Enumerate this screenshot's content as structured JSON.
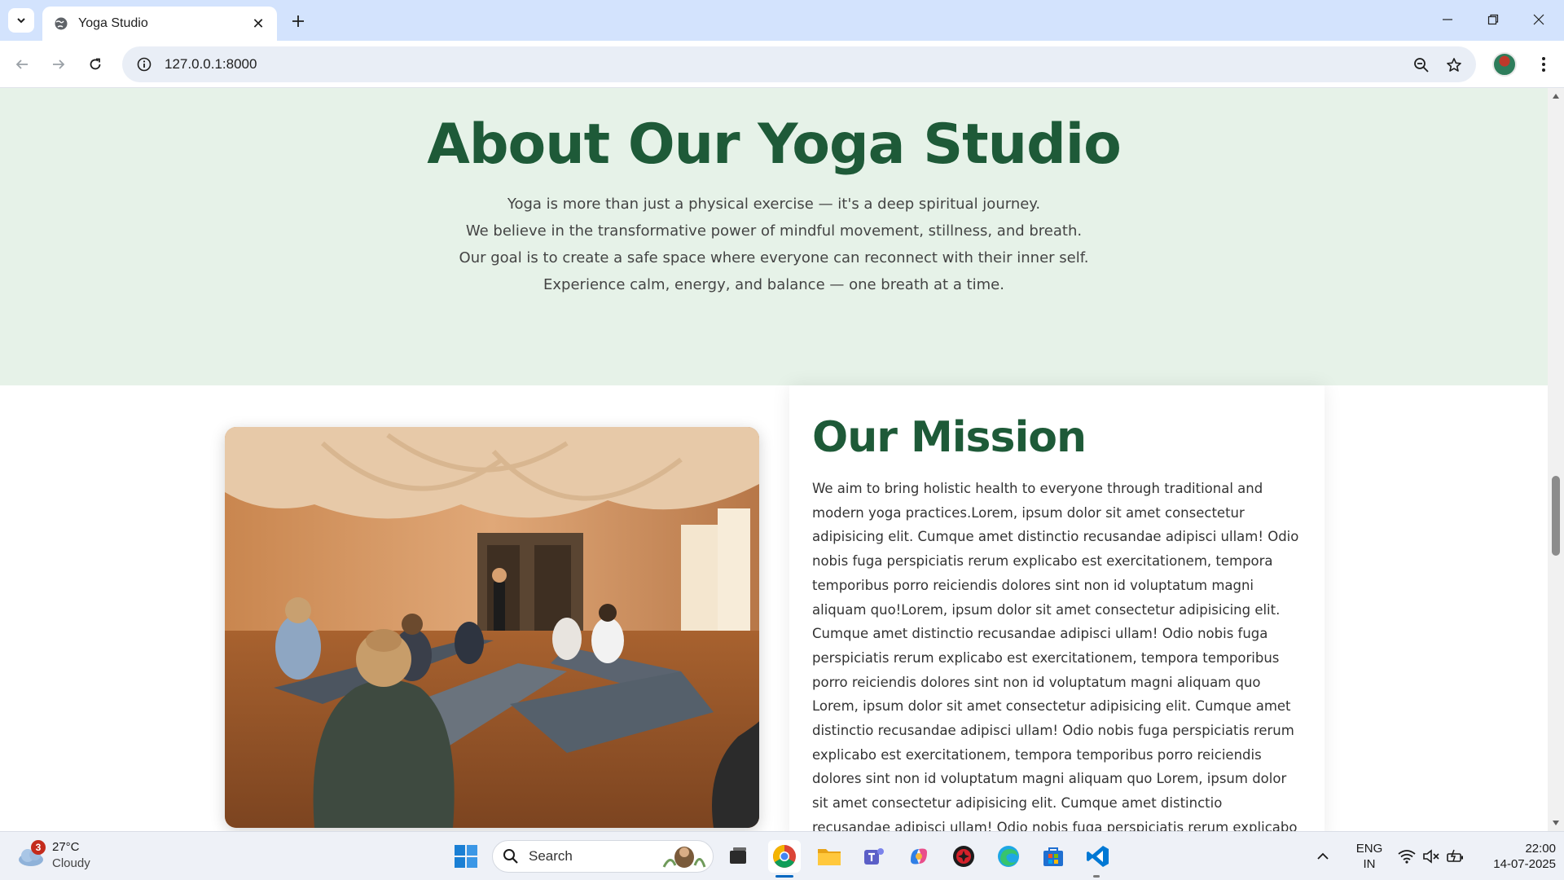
{
  "browser": {
    "tab_title": "Yoga Studio",
    "url": "127.0.0.1:8000"
  },
  "about": {
    "title": "About Our Yoga Studio",
    "lines": [
      "Yoga is more than just a physical exercise — it's a deep spiritual journey.",
      "We believe in the transformative power of mindful movement, stillness, and breath.",
      "Our goal is to create a safe space where everyone can reconnect with their inner self.",
      "Experience calm, energy, and balance — one breath at a time."
    ]
  },
  "mission": {
    "title": "Our Mission",
    "text": "We aim to bring holistic health to everyone through traditional and modern yoga practices.Lorem, ipsum dolor sit amet consectetur adipisicing elit. Cumque amet distinctio recusandae adipisci ullam! Odio nobis fuga perspiciatis rerum explicabo est exercitationem, tempora temporibus porro reiciendis dolores sint non id voluptatum magni aliquam quo!Lorem, ipsum dolor sit amet consectetur adipisicing elit. Cumque amet distinctio recusandae adipisci ullam! Odio nobis fuga perspiciatis rerum explicabo est exercitationem, tempora temporibus porro reiciendis dolores sint non id voluptatum magni aliquam quo Lorem, ipsum dolor sit amet consectetur adipisicing elit. Cumque amet distinctio recusandae adipisci ullam! Odio nobis fuga perspiciatis rerum explicabo est exercitationem, tempora temporibus porro reiciendis dolores sint non id voluptatum magni aliquam quo Lorem, ipsum dolor sit amet consectetur adipisicing elit. Cumque amet distinctio recusandae adipisci ullam! Odio nobis fuga perspiciatis rerum explicabo est exercitationem, tempora temporibus porro reiciendis dolores sint non id voluptatum magni aliquam quo"
  },
  "taskbar": {
    "weather_temp": "27°C",
    "weather_desc": "Cloudy",
    "weather_badge": "3",
    "search_label": "Search",
    "lang_1": "ENG",
    "lang_2": "IN",
    "time": "22:00",
    "date": "14-07-2025"
  },
  "colors": {
    "heading_green": "#1e5a38",
    "about_bg": "#e6f2e8",
    "tabstrip_bg": "#d3e3fd"
  }
}
